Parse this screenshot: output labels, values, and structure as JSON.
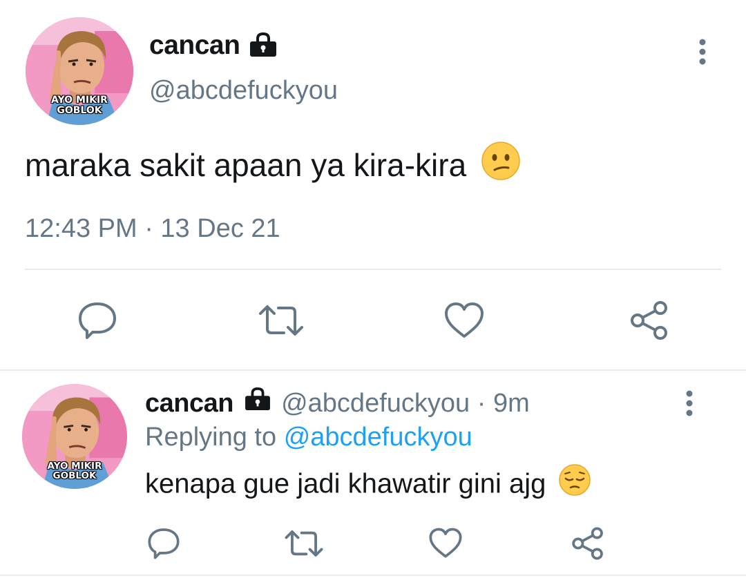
{
  "main_tweet": {
    "name": "cancan",
    "handle": "@abcdefuckyou",
    "text": "maraka sakit apaan ya kira-kira",
    "timestamp": "12:43 PM · 13 Dec 21",
    "avatar_caption_line1": "AYO MIKIR",
    "avatar_caption_line2": "GOBLOK",
    "icons": [
      "lock-icon",
      "more-options-icon",
      "confused-face-emoji",
      "reply-icon",
      "retweet-icon",
      "like-icon",
      "share-icon"
    ]
  },
  "reply_tweet": {
    "name": "cancan",
    "handle": "@abcdefuckyou",
    "separator": "·",
    "time": "9m",
    "replying_prefix": "Replying to",
    "replying_to": "@abcdefuckyou",
    "text": "kenapa gue jadi khawatir gini ajg",
    "avatar_caption_line1": "AYO MIKIR",
    "avatar_caption_line2": "GOBLOK",
    "icons": [
      "lock-icon",
      "more-options-icon",
      "pensive-face-emoji",
      "reply-icon",
      "retweet-icon",
      "like-icon",
      "share-icon"
    ]
  },
  "colors": {
    "text_primary": "#14171a",
    "text_secondary": "#657786",
    "link": "#1da1f2",
    "divider": "#e6ecf0",
    "emoji_yellow": "#ffcc4d"
  }
}
